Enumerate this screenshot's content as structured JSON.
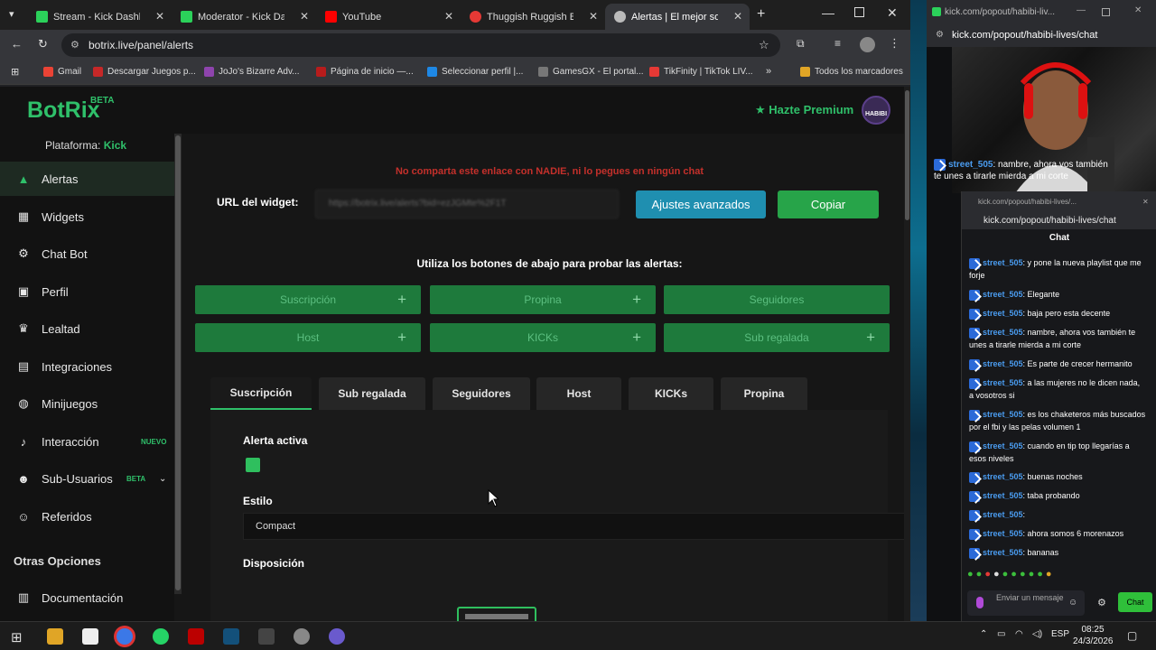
{
  "browser": {
    "tabs": [
      {
        "label": "Stream - Kick Dashb",
        "color": "#2bd15a"
      },
      {
        "label": "Moderator - Kick Dashb",
        "color": "#2bd15a"
      },
      {
        "label": "YouTube",
        "color": "#ff0000"
      },
      {
        "label": "Thuggish Ruggish B",
        "color": "#e53935"
      },
      {
        "label": "Alertas | El mejor softw",
        "color": "#bbbbbb"
      }
    ],
    "url": "botrix.live/panel/alerts",
    "bookmarks": [
      {
        "label": "Gmail",
        "color": "#ea4335"
      },
      {
        "label": "Descargar Juegos p...",
        "color": "#c62828"
      },
      {
        "label": "JoJo's Bizarre Adv...",
        "color": "#8e44ad"
      },
      {
        "label": "Página de inicio —...",
        "color": "#b71c1c"
      },
      {
        "label": "Seleccionar perfil |...",
        "color": "#1e88e5"
      },
      {
        "label": "GamesGX - El portal...",
        "color": "#777777"
      },
      {
        "label": "TikFinity | TikTok LIV...",
        "color": "#e53935"
      }
    ],
    "all_bookmarks": "Todos los marcadores"
  },
  "app": {
    "logo": "BotRix",
    "beta": "BETA",
    "premium": "Hazte Premium",
    "avatar_text": "HABIBI",
    "platform_label": "Plataforma:",
    "platform_value": "Kick"
  },
  "sidebar": {
    "items": [
      {
        "label": "Alertas",
        "icon": "warning-icon"
      },
      {
        "label": "Widgets",
        "icon": "grid-icon"
      },
      {
        "label": "Chat Bot",
        "icon": "robot-icon"
      },
      {
        "label": "Perfil",
        "icon": "profile-icon"
      },
      {
        "label": "Lealtad",
        "icon": "trophy-icon"
      },
      {
        "label": "Integraciones",
        "icon": "integrations-icon"
      },
      {
        "label": "Minijuegos",
        "icon": "gamepad-icon"
      },
      {
        "label": "Interacción",
        "icon": "music-icon",
        "tag": "NUEVO"
      },
      {
        "label": "Sub-Usuarios",
        "icon": "users-icon",
        "tag": "BETA"
      },
      {
        "label": "Referidos",
        "icon": "referral-icon"
      }
    ],
    "section_other": "Otras Opciones",
    "docs": "Documentación"
  },
  "main": {
    "warning": "No comparta este enlace con NADIE, ni lo pegues en ningún chat",
    "widget_url_label": "URL del widget:",
    "widget_url_value": "https://botrix.live/alerts?bid=ezJGMte%2F1T",
    "advanced_button": "Ajustes avanzados",
    "copy_button": "Copiar",
    "hint": "Utiliza los botones de abajo para probar las alertas:",
    "test_buttons": [
      {
        "label": "Suscripción",
        "plus": true
      },
      {
        "label": "Propina",
        "plus": true
      },
      {
        "label": "Seguidores",
        "plus": false
      },
      {
        "label": "Host",
        "plus": true
      },
      {
        "label": "KICKs",
        "plus": true
      },
      {
        "label": "Sub regalada",
        "plus": true
      }
    ],
    "tabs": [
      "Suscripción",
      "Sub regalada",
      "Seguidores",
      "Host",
      "KICKs",
      "Propina"
    ],
    "active_tab": "Suscripción",
    "alert_active_label": "Alerta activa",
    "alert_active": true,
    "style_label": "Estilo",
    "style_value": "Compact",
    "layout_label": "Disposición"
  },
  "popout": {
    "title": "kick.com/popout/habibi-liv...",
    "url": "kick.com/popout/habibi-lives/chat",
    "bg_messages": [
      {
        "user": "street_505",
        "text": ": nambre, ahora vos también te unes a tirarle mierda a mi corte"
      }
    ],
    "inner_title": "kick.com/popout/habibi-lives/...",
    "inner_url": "kick.com/popout/habibi-lives/chat",
    "chat_header": "Chat",
    "messages": [
      {
        "user": "street_505",
        "text": ": y pone la nueva playlist que me forje"
      },
      {
        "user": "street_505",
        "text": ": Elegante"
      },
      {
        "user": "street_505",
        "text": ": baja pero esta decente"
      },
      {
        "user": "street_505",
        "text": ": nambre, ahora vos también te unes a tirarle mierda a mi corte"
      },
      {
        "user": "street_505",
        "text": ": Es parte de crecer hermanito"
      },
      {
        "user": "street_505",
        "text": ": a las mujeres no le dicen nada, a vosotros si"
      },
      {
        "user": "street_505",
        "text": ": es los chaketeros más buscados por el fbi y las pelas volumen 1"
      },
      {
        "user": "street_505",
        "text": ": cuando en tip top llegarías a esos niveles"
      },
      {
        "user": "street_505",
        "text": ": buenas noches"
      },
      {
        "user": "street_505",
        "text": ": taba probando"
      },
      {
        "user": "street_505",
        "text": ":"
      },
      {
        "user": "street_505",
        "text": ": ahora somos 6 morenazos"
      },
      {
        "user": "street_505",
        "text": ": bananas"
      }
    ],
    "input_placeholder": "Enviar un mensaje",
    "chat_button": "Chat"
  },
  "taskbar": {
    "lang": "ESP",
    "time": "08:25",
    "date": "24/3/2026"
  },
  "colors": {
    "accent": "#2fc06a",
    "warning": "#c4302b",
    "advanced": "#1f8fb0",
    "copy": "#27a449"
  }
}
